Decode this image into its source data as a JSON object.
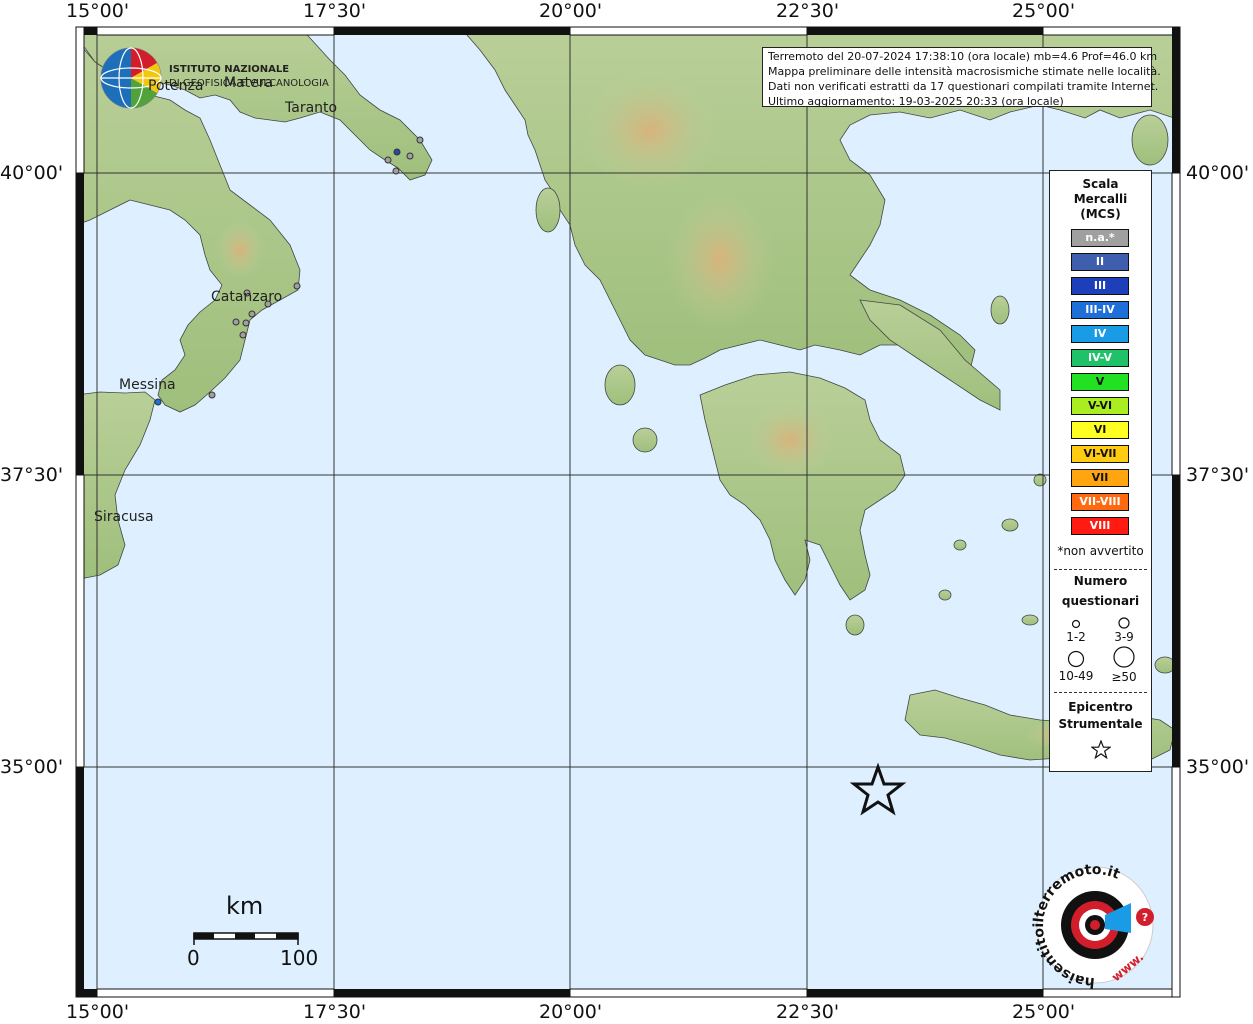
{
  "map": {
    "longitude_labels": [
      "15°00'",
      "17°30'",
      "20°00'",
      "22°30'",
      "25°00'"
    ],
    "latitude_labels": [
      "40°00'",
      "37°30'",
      "35°00'"
    ]
  },
  "info": {
    "line1": "Terremoto del 20-07-2024 17:38:10 (ora locale) mb=4.6 Prof=46.0 km",
    "line2": "Mappa preliminare delle intensità macrosismiche stimate nelle località.",
    "line3": "Dati non verificati estratti da 17 questionari compilati tramite Internet.",
    "line4": "Ultimo aggiornamento: 19-03-2025 20:33 (ora locale)"
  },
  "institute": {
    "line1": "ISTITUTO NAZIONALE",
    "line2": "DI GEOFISICA E VULCANOLOGIA"
  },
  "cities": [
    {
      "name": "Potenza"
    },
    {
      "name": "Matera"
    },
    {
      "name": "Taranto"
    },
    {
      "name": "Catanzaro"
    },
    {
      "name": "Messina"
    },
    {
      "name": "Siracusa"
    }
  ],
  "legend": {
    "title_line1": "Scala",
    "title_line2": "Mercalli",
    "title_line3": "(MCS)",
    "intensities": [
      {
        "label": "n.a.*",
        "color": "#a0a0a0"
      },
      {
        "label": "II",
        "color": "#3f5fae"
      },
      {
        "label": "III",
        "color": "#1d3fb9"
      },
      {
        "label": "III-IV",
        "color": "#1e6fd8"
      },
      {
        "label": "IV",
        "color": "#1a9be6"
      },
      {
        "label": "IV-V",
        "color": "#1fc268"
      },
      {
        "label": "V",
        "color": "#22e022"
      },
      {
        "label": "V-VI",
        "color": "#aaee22"
      },
      {
        "label": "VI",
        "color": "#ffff22"
      },
      {
        "label": "VI-VII",
        "color": "#ffcc11"
      },
      {
        "label": "VII",
        "color": "#ffa510"
      },
      {
        "label": "VII-VIII",
        "color": "#ff6a10"
      },
      {
        "label": "VIII",
        "color": "#ff1a12"
      }
    ],
    "not_felt_note": "*non avvertito",
    "count_title_line1": "Numero",
    "count_title_line2": "questionari",
    "count_sizes": [
      "1-2",
      "3-9",
      "10-49",
      "≥50"
    ],
    "epicenter_line1": "Epicentro",
    "epicenter_line2": "Strumentale"
  },
  "scalebar": {
    "unit": "km",
    "min": "0",
    "max": "100"
  },
  "brand": {
    "text": "haisentitoilterremoto.it",
    "prefix": "www."
  }
}
